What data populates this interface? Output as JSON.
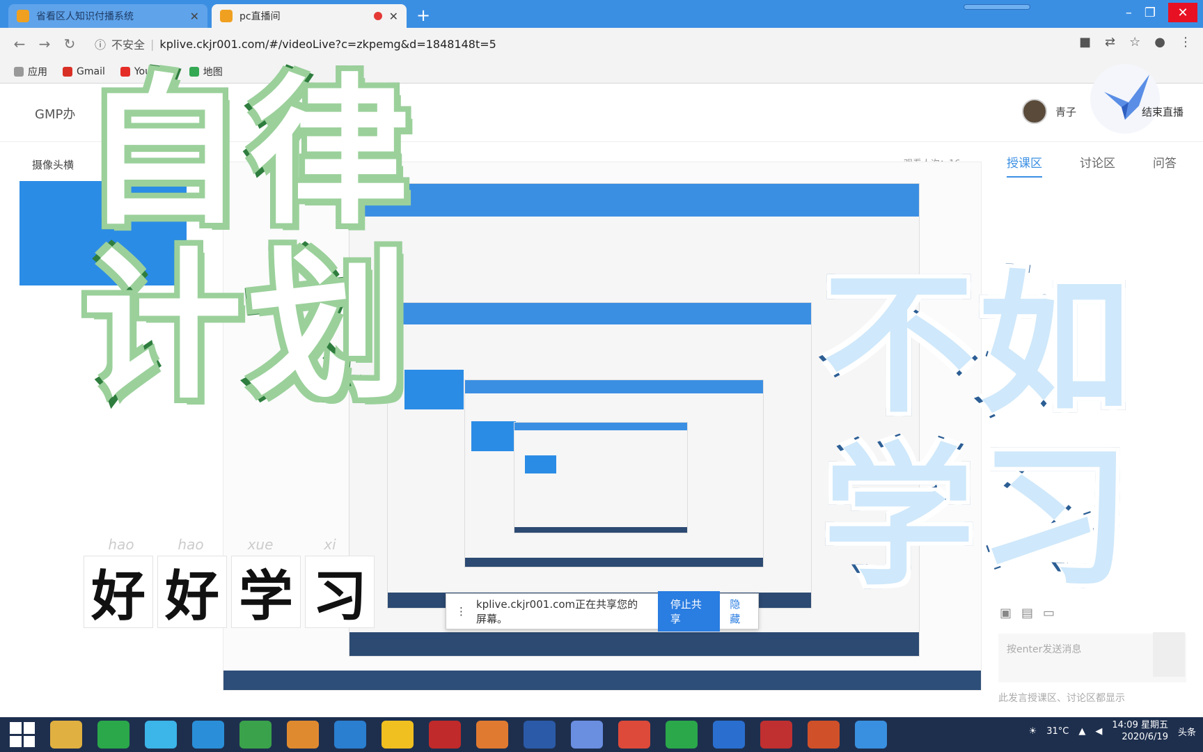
{
  "browser": {
    "tabs": [
      {
        "title": "省看区人知识付播系统",
        "active": false
      },
      {
        "title": "pc直播间",
        "active": true
      }
    ],
    "url_secure_label": "不安全",
    "url": "kplive.ckjr001.com/#/videoLive?c=zkpemg&d=1848148t=5",
    "bookmarks": [
      "应用",
      "Gmail",
      "YouTube",
      "地图"
    ]
  },
  "page": {
    "site_name": "GMP办",
    "user_name": "青子",
    "end_live": "结束直播",
    "camera_label": "摄像头横",
    "viewers": "观看人次：16",
    "right_tabs": [
      "授课区",
      "讨论区",
      "问答"
    ],
    "chat_placeholder": "按enter发送消息",
    "chat_hint": "此发言授课区、讨论区都显示"
  },
  "share_notice": {
    "text": "kplive.ckjr001.com正在共享您的屏幕。",
    "stop": "停止共享",
    "hide": "隐藏"
  },
  "overlay": {
    "green_line1": "自律",
    "green_line2": "计划",
    "blue_line1": "不如",
    "blue_line2": "学习",
    "pinyin": [
      "hao",
      "hao",
      "xue",
      "xi"
    ],
    "hanzi": [
      "好",
      "好",
      "学",
      "习"
    ]
  },
  "taskbar": {
    "weather": "31°C",
    "time": "14:09 星期五",
    "date": "2020/6/19",
    "news": "头条"
  },
  "colors": {
    "chrome_blue": "#3b8fe3",
    "green_stroke": "#2e7d3e",
    "blue_stroke": "#2c5e94",
    "taskbar": "#1e2f4e"
  }
}
